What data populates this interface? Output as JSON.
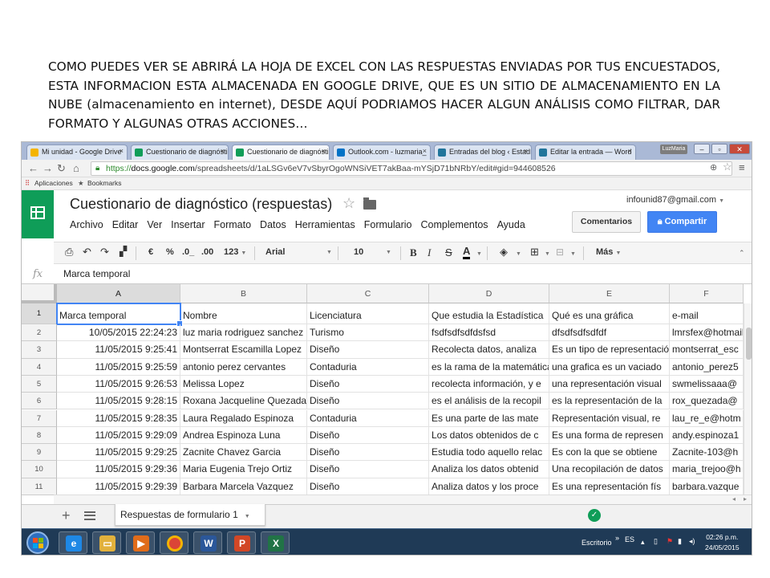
{
  "caption": "COMO PUEDES VER SE ABRIRÁ LA HOJA DE EXCEL CON LAS RESPUESTAS ENVIADAS POR TUS ENCUESTADOS, ESTA INFORMACION ESTA ALMACENADA EN GOOGLE DRIVE, QUE ES UN SITIO DE ALMACENAMIENTO EN LA NUBE (almacenamiento en internet), DESDE AQUÍ PODRIAMOS HACER ALGUN ANÁLISIS COMO FILTRAR, DAR FORMATO Y ALGUNAS OTRAS ACCIONES…",
  "browser": {
    "tabs": [
      {
        "label": "Mi unidad - Google Drive",
        "color": "#f4b400"
      },
      {
        "label": "Cuestionario de diagnóstico",
        "color": "#0f9d58"
      },
      {
        "label": "Cuestionario de diagnóstico",
        "color": "#0f9d58"
      },
      {
        "label": "Outlook.com - luzmaria_",
        "color": "#0072c6"
      },
      {
        "label": "Entradas del blog ‹ Estadí",
        "color": "#21759b"
      },
      {
        "label": "Editar la entrada — Word",
        "color": "#21759b"
      }
    ],
    "user_badge": "LuzMaria",
    "url_scheme": "https://",
    "url_host": "docs.google.com",
    "url_path": "/spreadsheets/d/1aLSGv6eV7vSbyrOgoWNSiVET7akBaa-mYSjD71bNRbY/edit#gid=944608526",
    "bookmarks": {
      "apps": "Aplicaciones",
      "bookmarks": "Bookmarks"
    }
  },
  "sheets": {
    "title": "Cuestionario de diagnóstico (respuestas)",
    "account": "infounid87@gmail.com",
    "menu": [
      "Archivo",
      "Editar",
      "Ver",
      "Insertar",
      "Formato",
      "Datos",
      "Herramientas",
      "Formulario",
      "Complementos",
      "Ayuda"
    ],
    "comments_button": "Comentarios",
    "share_button": "Compartir",
    "toolbar": {
      "currency": "€",
      "percent": "%",
      "dec_less": ".0_",
      "dec_more": ".00",
      "format_123": "123",
      "font": "Arial",
      "font_size": "10",
      "bold": "B",
      "italic": "I",
      "strike": "S",
      "text_color": "A",
      "more": "Más"
    },
    "fx_label": "fx",
    "formula_value": "Marca temporal",
    "columns": [
      "A",
      "B",
      "C",
      "D",
      "E",
      "F"
    ],
    "header_row": [
      "Marca temporal",
      "Nombre",
      "Licenciatura",
      "Que estudia la Estadística",
      "Qué es una gráfica",
      "e-mail"
    ],
    "rows": [
      {
        "n": "2",
        "cells": [
          "10/05/2015 22:24:23",
          "luz maria rodriguez sanchez",
          "Turismo",
          "fsdfsdfsdfdsfsd",
          "dfsdfsdfsdfdf",
          "lmrsfex@hotmail.com"
        ]
      },
      {
        "n": "3",
        "cells": [
          "11/05/2015 9:25:41",
          "Montserrat Escamilla Lopez",
          "Diseño",
          "Recolecta datos, analiza",
          "Es un tipo de representación",
          "montserrat_esc"
        ]
      },
      {
        "n": "4",
        "cells": [
          "11/05/2015 9:25:59",
          "antonio perez cervantes",
          "Contaduria",
          "es la rama de la matemática",
          "una grafica es un vaciado",
          "antonio_perez5"
        ]
      },
      {
        "n": "5",
        "cells": [
          "11/05/2015 9:26:53",
          "Melissa Lopez",
          "Diseño",
          "recolecta información, y e",
          "una representación visual",
          "swmelissaaa@"
        ]
      },
      {
        "n": "6",
        "cells": [
          "11/05/2015 9:28:15",
          "Roxana Jacqueline Quezada",
          "Diseño",
          "es el análisis de la recopil",
          "es la representación de la",
          "rox_quezada@"
        ]
      },
      {
        "n": "7",
        "cells": [
          "11/05/2015 9:28:35",
          "Laura Regalado Espinoza",
          "Contaduria",
          "Es una parte de las mate",
          "Representación visual, re",
          "lau_re_e@hotm"
        ]
      },
      {
        "n": "8",
        "cells": [
          "11/05/2015 9:29:09",
          "Andrea Espinoza Luna",
          "Diseño",
          "Los datos obtenidos de c",
          "Es una forma de represen",
          "andy.espinoza1"
        ]
      },
      {
        "n": "9",
        "cells": [
          "11/05/2015 9:29:25",
          "Zacnite Chavez Garcia",
          "Diseño",
          "Estudia todo aquello relac",
          "Es con la que se obtiene",
          "Zacnite-103@h"
        ]
      },
      {
        "n": "10",
        "cells": [
          "11/05/2015 9:29:36",
          "Maria Eugenia Trejo Ortiz",
          "Diseño",
          "Analiza los datos obtenid",
          "Una recopilación de datos",
          "maria_trejoo@h"
        ]
      },
      {
        "n": "11",
        "cells": [
          "11/05/2015 9:29:39",
          "Barbara Marcela Vazquez",
          "Diseño",
          "Analiza datos y los proce",
          "Es una representación fís",
          "barbara.vazque"
        ]
      }
    ],
    "header_row_number": "1",
    "sheet_tab": "Respuestas de formulario 1"
  },
  "taskbar": {
    "desktop_label": "Escritorio",
    "language": "ES",
    "time": "02:26 p.m.",
    "date": "24/05/2015"
  }
}
